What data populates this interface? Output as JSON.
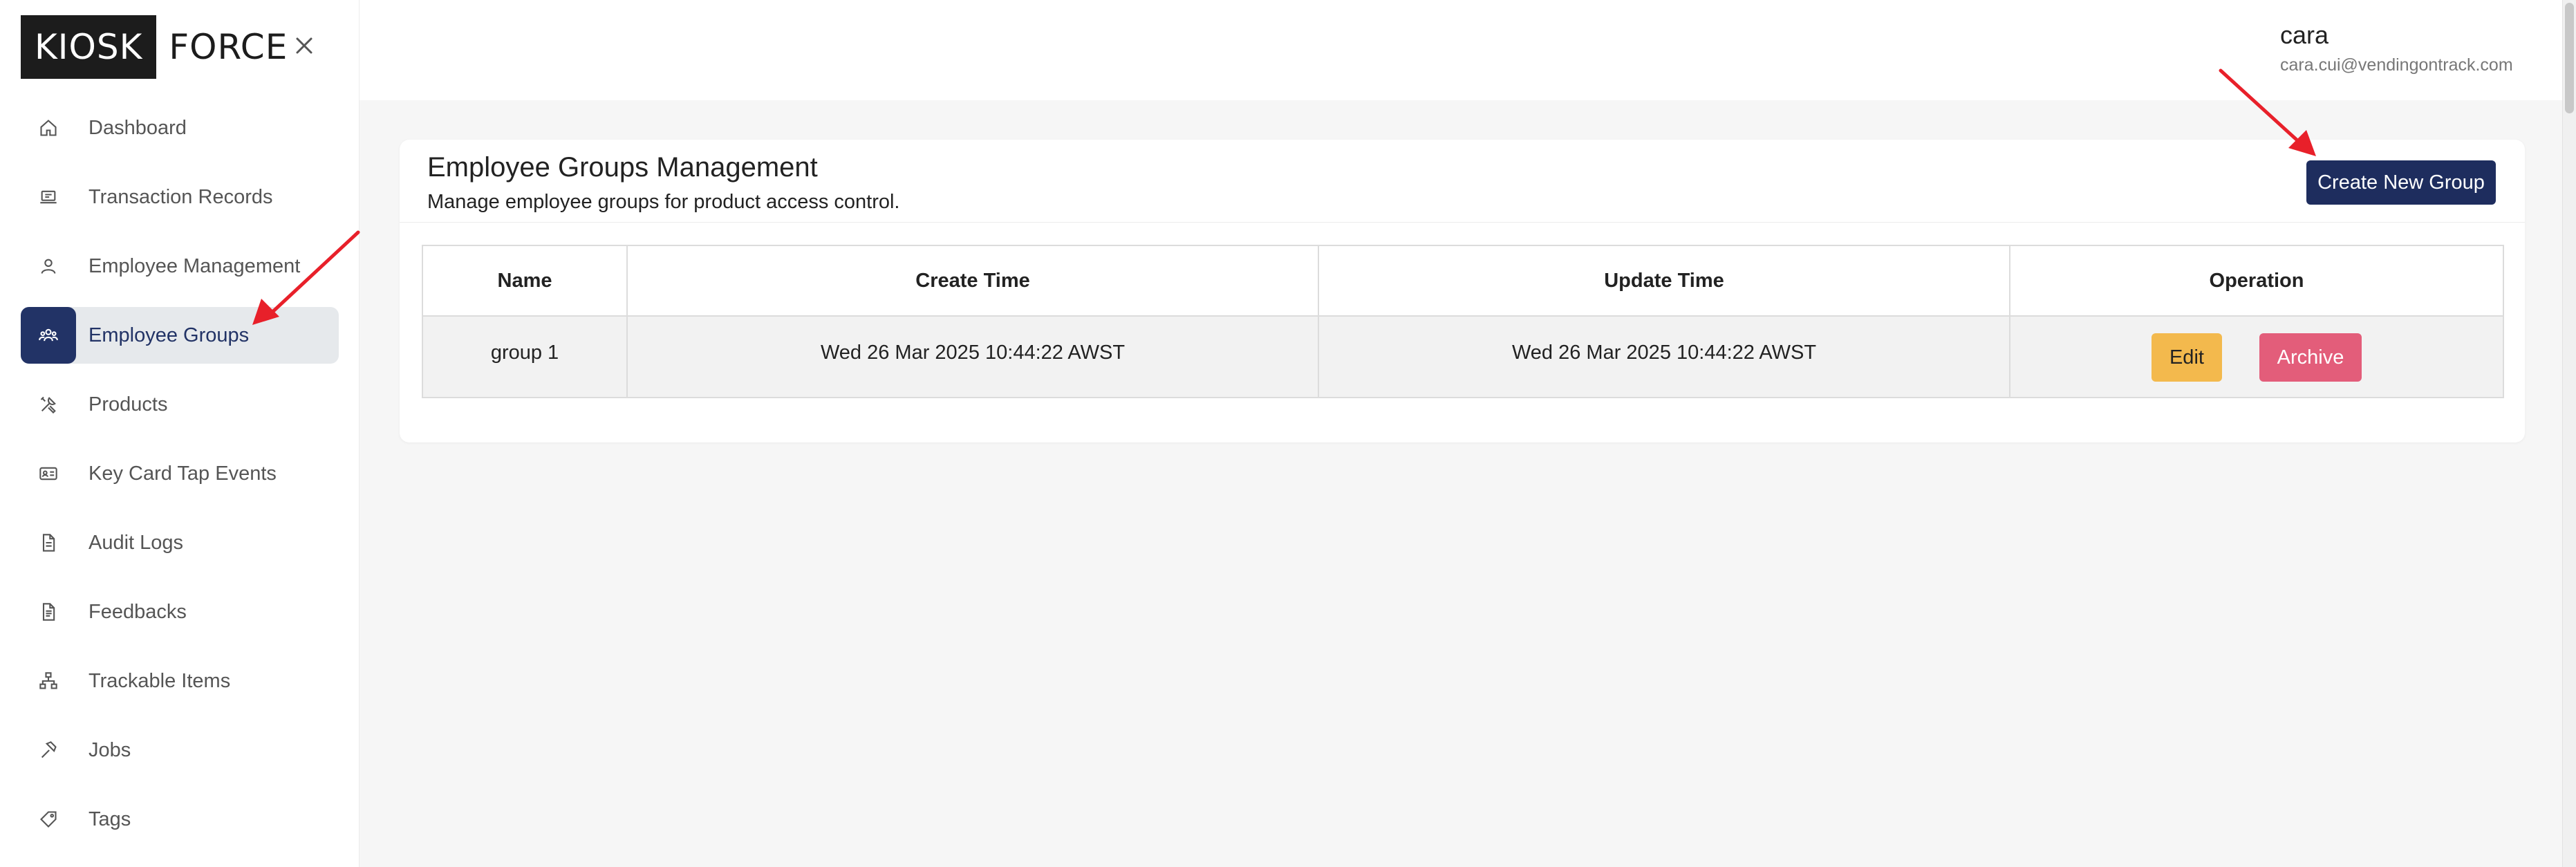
{
  "brand": {
    "part1": "KIOSK",
    "part2": "FORCE"
  },
  "sidebar": {
    "items": [
      {
        "label": "Dashboard",
        "icon": "home-icon",
        "active": false
      },
      {
        "label": "Transaction Records",
        "icon": "receipt-icon",
        "active": false
      },
      {
        "label": "Employee Management",
        "icon": "user-icon",
        "active": false
      },
      {
        "label": "Employee Groups",
        "icon": "group-icon",
        "active": true
      },
      {
        "label": "Products",
        "icon": "tools-icon",
        "active": false
      },
      {
        "label": "Key Card Tap Events",
        "icon": "id-card-icon",
        "active": false
      },
      {
        "label": "Audit Logs",
        "icon": "document-icon",
        "active": false
      },
      {
        "label": "Feedbacks",
        "icon": "feedback-icon",
        "active": false
      },
      {
        "label": "Trackable Items",
        "icon": "hierarchy-icon",
        "active": false
      },
      {
        "label": "Jobs",
        "icon": "hammer-icon",
        "active": false
      },
      {
        "label": "Tags",
        "icon": "tag-icon",
        "active": false
      }
    ]
  },
  "header": {
    "user_name": "cara",
    "user_email": "cara.cui@vendingontrack.com"
  },
  "main": {
    "title": "Employee Groups Management",
    "subtitle": "Manage employee groups for product access control.",
    "create_button": "Create New Group",
    "table": {
      "columns": [
        "Name",
        "Create Time",
        "Update Time",
        "Operation"
      ],
      "rows": [
        {
          "name": "group 1",
          "create_time": "Wed 26 Mar 2025 10:44:22 AWST",
          "update_time": "Wed 26 Mar 2025 10:44:22 AWST",
          "edit_label": "Edit",
          "archive_label": "Archive"
        }
      ]
    }
  },
  "colors": {
    "accent": "#223366",
    "create_button": "#1e2d5e",
    "edit_button": "#f3b94d",
    "archive_button": "#e35d7a",
    "annotation_arrow": "#e8202a"
  }
}
